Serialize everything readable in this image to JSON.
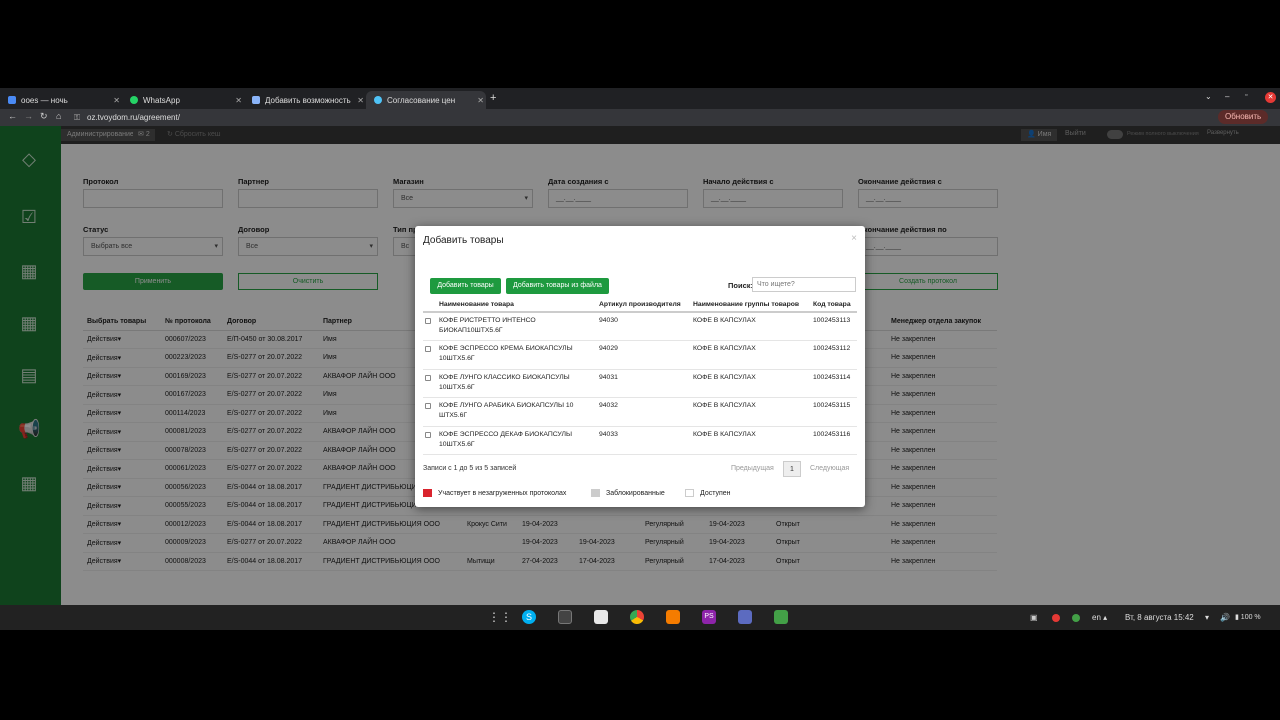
{
  "tabs": [
    {
      "label": "ooes — ночь",
      "color": "#4a8af4"
    },
    {
      "label": "WhatsApp",
      "color": "#25d366"
    },
    {
      "label": "Добавить возможность",
      "color": "#8ab4f8"
    },
    {
      "label": "Согласование цен",
      "color": "#4fc3f7"
    }
  ],
  "address": {
    "url": "oz.tvoydom.ru/agreement/",
    "update_label": "Обновить"
  },
  "topstrip": {
    "admin": "Администрирование",
    "count": "2",
    "reset": "Сбросить кеш",
    "user": "Имя",
    "logout": "Выйти",
    "mode": "Режим полного выключения",
    "expand": "Развернуть"
  },
  "filters": {
    "protocol": "Протокол",
    "partner": "Партнер",
    "store": "Магазин",
    "store_value": "Все",
    "created_from": "Дата создания с",
    "start_from": "Начало действия с",
    "end_from": "Окончание действия с",
    "date_placeholder": "__.__.____",
    "status": "Статус",
    "status_value": "Выбрать все",
    "contract": "Договор",
    "contract_value": "Все",
    "type": "Тип пр",
    "type_value": "Вс",
    "end_to": "Окончание действия по",
    "apply": "Применить",
    "clear": "Очистить",
    "create": "Создать протокол"
  },
  "bg_table": {
    "headers": [
      "Выбрать товары",
      "№ протокола",
      "Договор",
      "Партнер"
    ],
    "manager_header": "Менеджер отдела закупок",
    "rows": [
      [
        "Действия▾",
        "000607/2023",
        "Е/П-0450 от 30.08.2017",
        "Имя",
        "",
        "",
        "",
        "",
        "",
        "",
        "Не закреплен"
      ],
      [
        "Действия▾",
        "000223/2023",
        "Е/S-0277 от 20.07.2022",
        "Имя",
        "",
        "",
        "",
        "",
        "",
        "",
        "Не закреплен"
      ],
      [
        "Действия▾",
        "000169/2023",
        "Е/S-0277 от 20.07.2022",
        "АКВАФОР ЛАЙН ООО",
        "",
        "",
        "",
        "",
        "",
        "",
        "Не закреплен"
      ],
      [
        "Действия▾",
        "000167/2023",
        "Е/S-0277 от 20.07.2022",
        "Имя",
        "",
        "",
        "",
        "",
        "",
        "",
        "Не закреплен"
      ],
      [
        "Действия▾",
        "000114/2023",
        "Е/S-0277 от 20.07.2022",
        "Имя",
        "",
        "",
        "",
        "",
        "",
        "",
        "Не закреплен"
      ],
      [
        "Действия▾",
        "000081/2023",
        "Е/S-0277 от 20.07.2022",
        "АКВАФОР ЛАЙН ООО",
        "",
        "",
        "",
        "",
        "",
        "",
        "Не закреплен"
      ],
      [
        "Действия▾",
        "000078/2023",
        "Е/S-0277 от 20.07.2022",
        "АКВАФОР ЛАЙН ООО",
        "",
        "",
        "",
        "",
        "",
        "",
        "Не закреплен"
      ],
      [
        "Действия▾",
        "000061/2023",
        "Е/S-0277 от 20.07.2022",
        "АКВАФОР ЛАЙН ООО",
        "",
        "",
        "",
        "",
        "",
        "",
        "Не закреплен"
      ],
      [
        "Действия▾",
        "000056/2023",
        "Е/S-0044 от 18.08.2017",
        "ГРАДИЕНТ ДИСТРИБЬЮЦИЯ ООО",
        "",
        "",
        "",
        "",
        "",
        "",
        "Не закреплен"
      ],
      [
        "Действия▾",
        "000055/2023",
        "Е/S-0044 от 18.08.2017",
        "ГРАДИЕНТ ДИСТРИБЬЮЦИЯ ООО",
        "",
        "",
        "",
        "",
        "",
        "",
        "Не закреплен"
      ],
      [
        "Действия▾",
        "000012/2023",
        "Е/S-0044 от 18.08.2017",
        "ГРАДИЕНТ ДИСТРИБЬЮЦИЯ ООО",
        "Крокус Сити",
        "19-04-2023",
        "",
        "Регулярный",
        "19-04-2023",
        "Открыт",
        "Не закреплен"
      ],
      [
        "Действия▾",
        "000009/2023",
        "Е/S-0277 от 20.07.2022",
        "АКВАФОР ЛАЙН ООО",
        "",
        "19-04-2023",
        "19-04-2023",
        "Регулярный",
        "19-04-2023",
        "Открыт",
        "Не закреплен"
      ],
      [
        "Действия▾",
        "000008/2023",
        "Е/S-0044 от 18.08.2017",
        "ГРАДИЕНТ ДИСТРИБЬЮЦИЯ ООО",
        "Мытищи",
        "27-04-2023",
        "17-04-2023",
        "Регулярный",
        "17-04-2023",
        "Открыт",
        "Не закреплен"
      ]
    ]
  },
  "modal": {
    "title": "Добавить товары",
    "close": "×",
    "add_btn": "Добавить товары",
    "add_file_btn": "Добавить товары из файла",
    "search_label": "Поиск:",
    "search_placeholder": "Что ищете?",
    "headers": [
      "Наименование товара",
      "Артикул производителя",
      "Наименование группы товаров",
      "Код товара"
    ],
    "rows": [
      [
        "КОФЕ РИСТРЕТТО ИНТЕНСО БИОКАП10ШТХ5.6Г",
        "94030",
        "КОФЕ В КАПСУЛАХ",
        "1002453113"
      ],
      [
        "КОФЕ ЭСПРЕССО КРЕМА БИОКАПСУЛЫ 10ШТХ5.6Г",
        "94029",
        "КОФЕ В КАПСУЛАХ",
        "1002453112"
      ],
      [
        "КОФЕ ЛУНГО КЛАССИКО БИОКАПСУЛЫ 10ШТХ5.6Г",
        "94031",
        "КОФЕ В КАПСУЛАХ",
        "1002453114"
      ],
      [
        "КОФЕ ЛУНГО АРАБИКА БИОКАПСУЛЫ 10 ШТХ5.6Г",
        "94032",
        "КОФЕ В КАПСУЛАХ",
        "1002453115"
      ],
      [
        "КОФЕ ЭСПРЕССО ДЕКАФ БИОКАПСУЛЫ 10ШТХ5.6Г",
        "94033",
        "КОФЕ В КАПСУЛАХ",
        "1002453116"
      ]
    ],
    "info": "Записи с 1 до 5 из 5 записей",
    "prev": "Предыдущая",
    "page": "1",
    "next": "Следующая",
    "legend": [
      {
        "label": "Участвует в незагруженных протоколах",
        "color": "#d9232d"
      },
      {
        "label": "Заблокированные",
        "color": "#cccccc"
      },
      {
        "label": "Доступен",
        "color": "#ffffff"
      }
    ]
  },
  "taskbar": {
    "lang": "en",
    "datetime": "Вт, 8 августа  15:42",
    "battery": "100 %"
  }
}
